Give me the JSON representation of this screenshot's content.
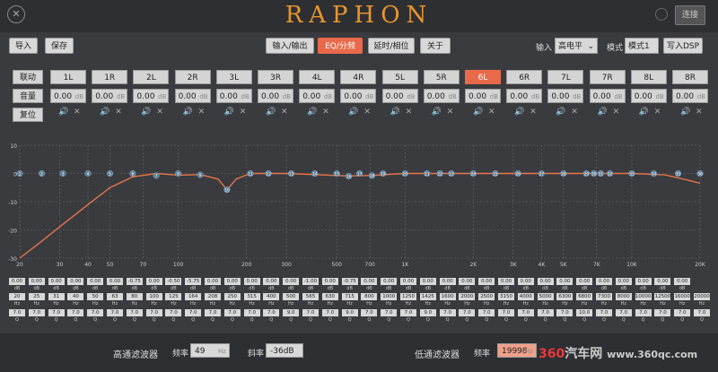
{
  "window": {
    "close_icon": "close-icon",
    "logo": "RAPHON",
    "connect": "连接"
  },
  "toolbar": {
    "import": "导入",
    "save": "保存",
    "tabs": [
      {
        "label": "输入/输出",
        "active": false
      },
      {
        "label": "EQ/分频",
        "active": true
      },
      {
        "label": "延时/相位",
        "active": false
      },
      {
        "label": "关于",
        "active": false
      }
    ],
    "input_label": "输入",
    "input_value": "高电平",
    "mode_label": "模式",
    "mode_value": "模式1",
    "write_dsp": "写入DSP"
  },
  "side": {
    "link": "联动",
    "volume": "音量",
    "reset": "复位"
  },
  "channels": {
    "labels": [
      "1L",
      "1R",
      "2L",
      "2R",
      "3L",
      "3R",
      "4L",
      "4R",
      "5L",
      "5R",
      "6L",
      "6R",
      "7L",
      "7R",
      "8L",
      "8R"
    ],
    "active": "6L",
    "volume": "0.00",
    "volume_unit": "dB"
  },
  "eq_params": {
    "gains": [
      "0.00",
      "0.00",
      "0.00",
      "0.00",
      "0.00",
      "0.00",
      "-0.75",
      "0.00",
      "-0.50",
      "-5.75",
      "0.00",
      "0.00",
      "0.00",
      "0.00",
      "0.00",
      "-1.00",
      "0.00",
      "-0.75",
      "0.00",
      "0.00",
      "0.00",
      "0.00",
      "0.00",
      "0.00",
      "0.00",
      "0.00",
      "0.00",
      "0.00",
      "0.00",
      "0.00",
      "0.00",
      "0.00",
      "0.00",
      "0.00",
      "0.00"
    ],
    "freqs": [
      "20",
      "25",
      "31",
      "40",
      "50",
      "63",
      "80",
      "100",
      "125",
      "164",
      "208",
      "250",
      "315",
      "400",
      "500",
      "565",
      "630",
      "715",
      "800",
      "1000",
      "1250",
      "1425",
      "1600",
      "2000",
      "2500",
      "3150",
      "4000",
      "5000",
      "6300",
      "6800",
      "7300",
      "8000",
      "10000",
      "12500",
      "16000",
      "20000"
    ],
    "qs": [
      "7.0",
      "7.0",
      "7.0",
      "7.0",
      "7.0",
      "7.0",
      "7.0",
      "7.0",
      "7.0",
      "7.0",
      "7.0",
      "7.0",
      "7.0",
      "7.0",
      "9.0",
      "7.0",
      "7.0",
      "9.0",
      "7.0",
      "7.0",
      "7.0",
      "9.0",
      "7.0",
      "7.0",
      "7.0",
      "7.0",
      "7.0",
      "7.0",
      "7.0",
      "10.0",
      "7.0",
      "7.0",
      "7.0",
      "7.0",
      "7.0",
      "7.0"
    ],
    "unit_db": "dB",
    "unit_hz": "Hz",
    "unit_q": "Q"
  },
  "chart_data": {
    "type": "line",
    "x_scale": "log",
    "xlim": [
      20,
      20000
    ],
    "ylim": [
      -30,
      10
    ],
    "x_ticks": [
      "20",
      "30",
      "40",
      "50",
      "70",
      "100",
      "200",
      "300",
      "500",
      "700",
      "1K",
      "2K",
      "3K",
      "4K",
      "5K",
      "7K",
      "10K",
      "20K"
    ],
    "y_ticks": [
      "10",
      "0",
      "-10",
      "-20",
      "-30"
    ],
    "bands": [
      {
        "n": 1,
        "f": 20
      },
      {
        "n": 2,
        "f": 25
      },
      {
        "n": 3,
        "f": 31
      },
      {
        "n": 4,
        "f": 40
      },
      {
        "n": 5,
        "f": 50
      },
      {
        "n": 6,
        "f": 63
      },
      {
        "n": 7,
        "f": 80
      },
      {
        "n": 8,
        "f": 100
      },
      {
        "n": 9,
        "f": 125
      },
      {
        "n": 10,
        "f": 164
      },
      {
        "n": 11,
        "f": 208
      },
      {
        "n": 12,
        "f": 250
      },
      {
        "n": 13,
        "f": 315
      },
      {
        "n": 14,
        "f": 400
      },
      {
        "n": 15,
        "f": 500
      },
      {
        "n": 16,
        "f": 565
      },
      {
        "n": 17,
        "f": 630
      },
      {
        "n": 18,
        "f": 715
      },
      {
        "n": 19,
        "f": 800
      },
      {
        "n": 20,
        "f": 1000
      },
      {
        "n": 21,
        "f": 1250
      },
      {
        "n": 22,
        "f": 1425
      },
      {
        "n": 23,
        "f": 1600
      },
      {
        "n": 24,
        "f": 2000
      },
      {
        "n": 25,
        "f": 2500
      },
      {
        "n": 26,
        "f": 3150
      },
      {
        "n": 27,
        "f": 4000
      },
      {
        "n": 28,
        "f": 5000
      },
      {
        "n": 29,
        "f": 6300
      },
      {
        "n": 30,
        "f": 6800
      },
      {
        "n": 31,
        "f": 7300
      },
      {
        "n": 32,
        "f": 8000
      },
      {
        "n": 33,
        "f": 10000
      },
      {
        "n": 34,
        "f": 12500
      },
      {
        "n": 35,
        "f": 16000
      },
      {
        "n": 36,
        "f": 20000
      }
    ],
    "curve": [
      [
        20,
        -30
      ],
      [
        25,
        -24
      ],
      [
        31,
        -18
      ],
      [
        40,
        -11
      ],
      [
        50,
        -5
      ],
      [
        63,
        -1.2
      ],
      [
        80,
        0
      ],
      [
        100,
        -0.6
      ],
      [
        125,
        -0.4
      ],
      [
        150,
        -2
      ],
      [
        164,
        -5.8
      ],
      [
        180,
        -2
      ],
      [
        208,
        0
      ],
      [
        300,
        0
      ],
      [
        565,
        -0.9
      ],
      [
        715,
        -0.7
      ],
      [
        1000,
        0
      ],
      [
        10000,
        0
      ],
      [
        14000,
        -0.5
      ],
      [
        18000,
        -2.5
      ],
      [
        20000,
        -3.5
      ]
    ],
    "color": "#e8744a"
  },
  "filters": {
    "hp_title": "高通滤波器",
    "freq_label": "频率",
    "hp_freq": "49",
    "hp_unit": "Hz",
    "slope_label": "斜率",
    "hp_slope": "-36dB",
    "lp_title": "低通滤波器",
    "lp_freq": "19998"
  },
  "watermark": {
    "brand": "360",
    "brand2": "汽车网",
    "url": "www.360qc.com"
  }
}
